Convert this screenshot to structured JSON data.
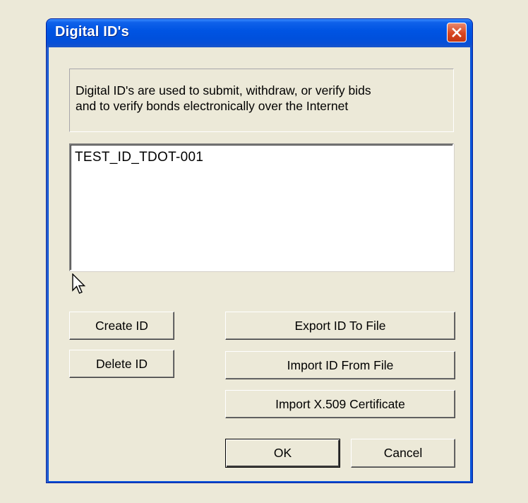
{
  "window": {
    "title": "Digital ID's",
    "close_label": "Close"
  },
  "description": {
    "line1": "Digital ID's are used to submit, withdraw, or verify bids",
    "line2": "and to verify bonds electronically over the Internet"
  },
  "id_list": {
    "items": [
      {
        "label": "TEST_ID_TDOT-001"
      }
    ]
  },
  "buttons": {
    "create_id": "Create ID",
    "delete_id": "Delete ID",
    "export_id": "Export ID To File",
    "import_id": "Import ID From File",
    "import_cert": "Import X.509 Certificate",
    "ok": "OK",
    "cancel": "Cancel"
  },
  "icons": {
    "close": "close-icon",
    "cursor": "mouse-pointer-icon"
  },
  "colors": {
    "titlebar": "#0054e3",
    "close_button": "#d8451f",
    "dialog_face": "#ece9d8"
  }
}
